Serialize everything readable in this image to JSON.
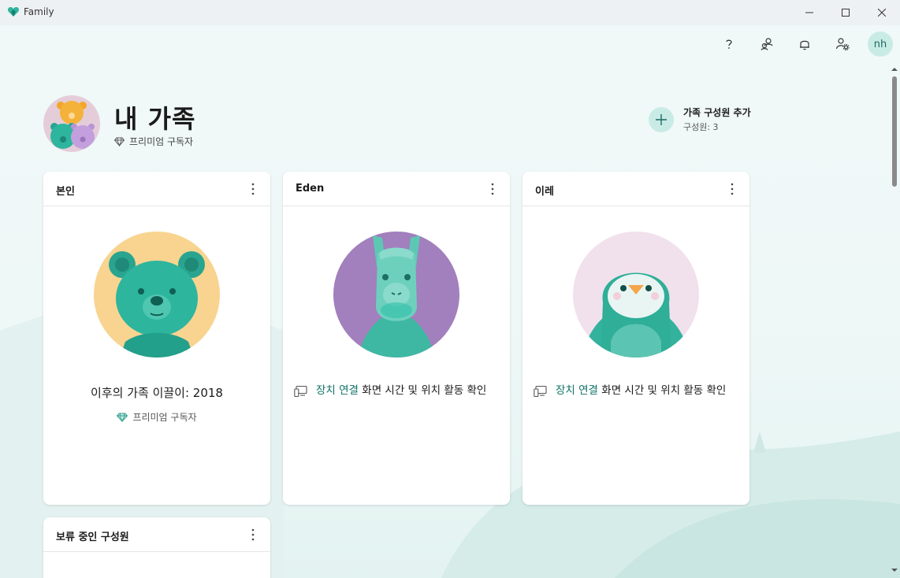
{
  "window": {
    "title": "Family"
  },
  "header": {
    "title": "내 가족",
    "subscription": "프리미엄 구독자",
    "add_member_label": "가족 구성원 추가",
    "member_count": "구성원: 3"
  },
  "topbar": {
    "avatar_initials": "nh"
  },
  "cards": [
    {
      "title": "본인",
      "name": "이후의 가족 이끌이: 2018",
      "subscription": "프리미엄 구독자"
    },
    {
      "title": "Eden",
      "link": "장치 연결",
      "desc": " 화면 시간 및 위치 활동 확인"
    },
    {
      "title": "이레",
      "link": "장치 연결",
      "desc": " 화면 시간 및 위치 활동 확인"
    }
  ],
  "pending": {
    "title": "보류 중인 구성원"
  },
  "colors": {
    "accent": "#0f7268",
    "teal": "#2fb5a0",
    "bear_bg": "#f8d490",
    "llama_bg": "#a27fbd",
    "penguin_bg": "#f1e1ec"
  },
  "icons": [
    "heart-logo-icon",
    "minimize-icon",
    "maximize-icon",
    "close-icon",
    "help-icon",
    "switch-account-icon",
    "bell-icon",
    "family-settings-icon",
    "diamond-icon",
    "plus-icon",
    "more-icon",
    "device-icon"
  ]
}
